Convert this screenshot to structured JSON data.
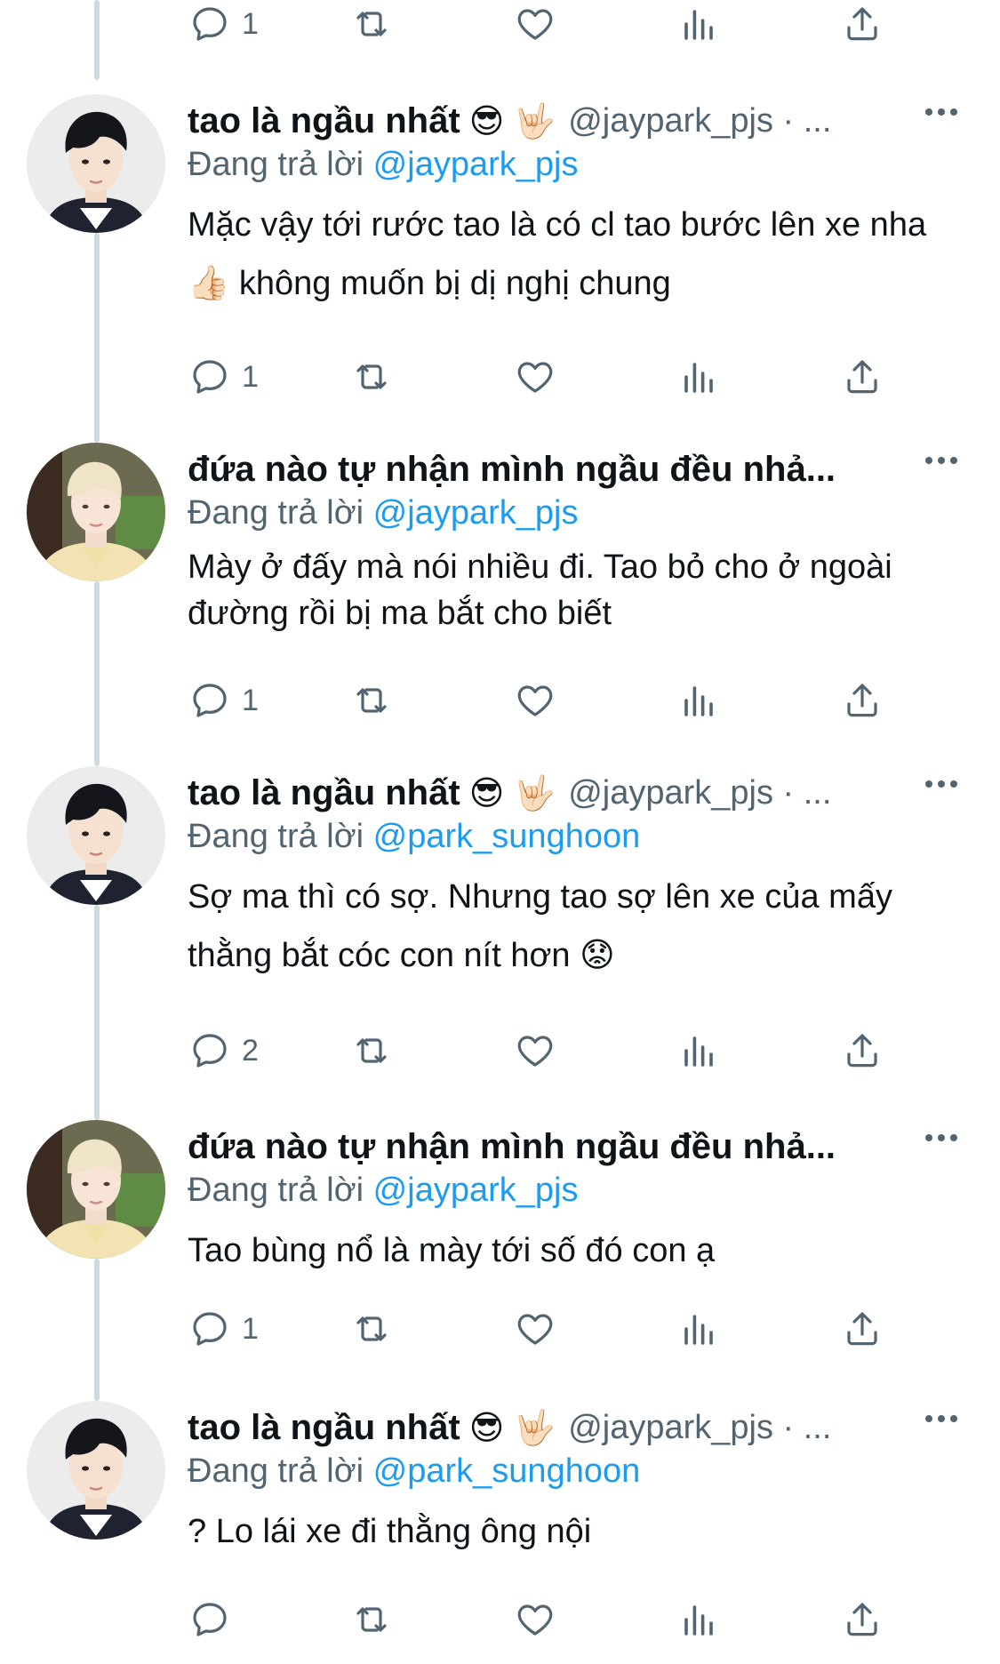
{
  "top_actions": {
    "reply_count": "1",
    "retweet_count": "",
    "like_count": ""
  },
  "tweets": [
    {
      "display_name": "tao là ngầu nhất",
      "emojis": "😎 🤟🏻",
      "handle": "@jaypark_pjs · ...",
      "reply_prefix": "Đang trả lời ",
      "reply_mention": "@jaypark_pjs",
      "text": "Mặc vậy tới rước tao là có cl tao bước lên xe nha 👍🏻  không muốn bị dị nghị chung",
      "reply_count": "1",
      "avatar": "dark-hair-avatar"
    },
    {
      "display_name": "đứa nào tự nhận mình ngầu đều nhả...",
      "emojis": "",
      "handle": "",
      "reply_prefix": "Đang trả lời ",
      "reply_mention": "@jaypark_pjs",
      "text": "Mày ở đấy mà nói nhiều đi. Tao bỏ cho ở ngoài đường rồi bị ma bắt cho biết",
      "reply_count": "1",
      "avatar": "blonde-hair-avatar"
    },
    {
      "display_name": "tao là ngầu nhất",
      "emojis": "😎 🤟🏻",
      "handle": "@jaypark_pjs · ...",
      "reply_prefix": "Đang trả lời ",
      "reply_mention": "@park_sunghoon",
      "text": "Sợ ma thì có sợ. Nhưng tao sợ lên xe của mấy thằng bắt cóc con nít hơn 😟",
      "reply_count": "2",
      "avatar": "dark-hair-avatar"
    },
    {
      "display_name": "đứa nào tự nhận mình ngầu đều nhả...",
      "emojis": "",
      "handle": "",
      "reply_prefix": "Đang trả lời ",
      "reply_mention": "@jaypark_pjs",
      "text": "Tao bùng nổ là mày tới số đó con ạ",
      "reply_count": "1",
      "avatar": "blonde-hair-avatar"
    },
    {
      "display_name": "tao là ngầu nhất",
      "emojis": "😎 🤟🏻",
      "handle": "@jaypark_pjs · ...",
      "reply_prefix": "Đang trả lời ",
      "reply_mention": "@park_sunghoon",
      "text": "? Lo lái xe đi thằng ông nội",
      "reply_count": "",
      "avatar": "dark-hair-avatar"
    }
  ]
}
